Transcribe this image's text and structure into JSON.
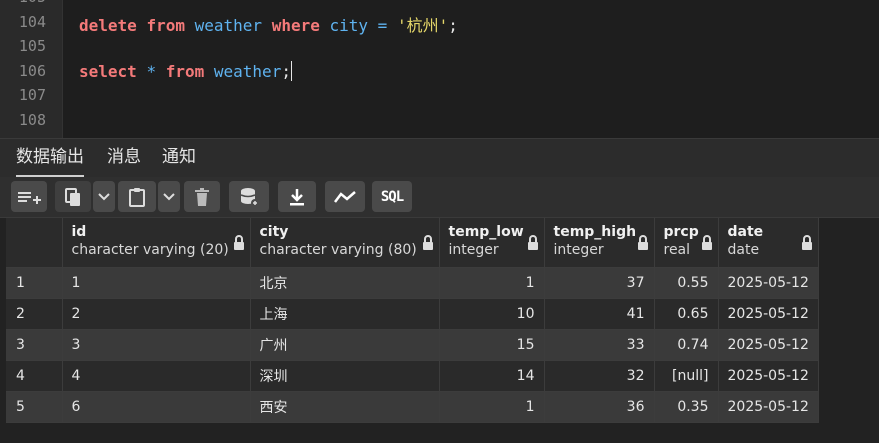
{
  "editor": {
    "line_numbers": [
      "105",
      "104",
      "105",
      "106",
      "107",
      "108"
    ],
    "line104": {
      "kw1": "delete",
      "kw2": "from",
      "tbl": "weather",
      "kw3": "where",
      "col": "city",
      "op": "=",
      "str": "'杭州'",
      "end": ";"
    },
    "line106": {
      "kw1": "select",
      "star": "*",
      "kw2": "from",
      "tbl": "weather",
      "end": ";"
    }
  },
  "tabs": [
    {
      "label": "数据输出",
      "active": true
    },
    {
      "label": "消息",
      "active": false
    },
    {
      "label": "通知",
      "active": false
    }
  ],
  "toolbar": {
    "icons": [
      "add-row-icon",
      "copy-icon",
      "chevron-down-icon",
      "paste-icon",
      "chevron-down-icon",
      "delete-icon",
      "save-data-icon",
      "download-icon",
      "graph-icon",
      "sql-icon"
    ],
    "sql_label": "SQL"
  },
  "grid": {
    "columns": [
      {
        "name": "id",
        "type": "character varying (20)"
      },
      {
        "name": "city",
        "type": "character varying (80)"
      },
      {
        "name": "temp_low",
        "type": "integer"
      },
      {
        "name": "temp_high",
        "type": "integer"
      },
      {
        "name": "prcp",
        "type": "real"
      },
      {
        "name": "date",
        "type": "date"
      }
    ],
    "rows": [
      {
        "rownum": "1",
        "id": "1",
        "city": "北京",
        "temp_low": "1",
        "temp_high": "37",
        "prcp": "0.55",
        "date": "2025-05-12"
      },
      {
        "rownum": "2",
        "id": "2",
        "city": "上海",
        "temp_low": "10",
        "temp_high": "41",
        "prcp": "0.65",
        "date": "2025-05-12"
      },
      {
        "rownum": "3",
        "id": "3",
        "city": "广州",
        "temp_low": "15",
        "temp_high": "33",
        "prcp": "0.74",
        "date": "2025-05-12"
      },
      {
        "rownum": "4",
        "id": "4",
        "city": "深圳",
        "temp_low": "14",
        "temp_high": "32",
        "prcp": "[null]",
        "date": "2025-05-12"
      },
      {
        "rownum": "5",
        "id": "6",
        "city": "西安",
        "temp_low": "1",
        "temp_high": "36",
        "prcp": "0.35",
        "date": "2025-05-12"
      }
    ]
  }
}
